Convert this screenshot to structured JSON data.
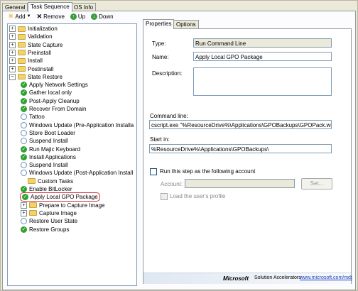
{
  "top_tabs": [
    "General",
    "Task Sequence",
    "OS Info"
  ],
  "toolbar": {
    "add": "Add",
    "remove": "Remove",
    "up": "Up",
    "down": "Down"
  },
  "tree": [
    {
      "label": "Initialization",
      "kind": "group",
      "level": 0
    },
    {
      "label": "Validation",
      "kind": "group",
      "level": 0
    },
    {
      "label": "State Capture",
      "kind": "group",
      "level": 0
    },
    {
      "label": "Preinstall",
      "kind": "group",
      "level": 0
    },
    {
      "label": "Install",
      "kind": "group",
      "level": 0
    },
    {
      "label": "Postinstall",
      "kind": "group",
      "level": 0
    },
    {
      "label": "State Restore",
      "kind": "group-open",
      "level": 0
    },
    {
      "label": "Apply Network Settings",
      "kind": "check",
      "level": 1
    },
    {
      "label": "Gather local only",
      "kind": "check",
      "level": 1
    },
    {
      "label": "Post-Apply Cleanup",
      "kind": "check",
      "level": 1
    },
    {
      "label": "Recover From Domain",
      "kind": "check",
      "level": 1
    },
    {
      "label": "Tattoo",
      "kind": "empty",
      "level": 1
    },
    {
      "label": "Windows Update (Pre-Application Installa",
      "kind": "empty",
      "level": 1
    },
    {
      "label": "Store Boot Loader",
      "kind": "empty",
      "level": 1
    },
    {
      "label": "Suspend Install",
      "kind": "empty",
      "level": 1
    },
    {
      "label": "Run Majic Keyboard",
      "kind": "check",
      "level": 1
    },
    {
      "label": "Install Applications",
      "kind": "check",
      "level": 1
    },
    {
      "label": "Suspend Install",
      "kind": "empty",
      "level": 1
    },
    {
      "label": "Windows Update (Post-Application Install",
      "kind": "empty",
      "level": 1
    },
    {
      "label": "Custom Tasks",
      "kind": "folder",
      "level": 1
    },
    {
      "label": "Enable BitLocker",
      "kind": "check",
      "level": 1
    },
    {
      "label": "Apply Local GPO Package",
      "kind": "check",
      "level": 1,
      "selected": true
    },
    {
      "label": "Prepare to Capture Image",
      "kind": "group",
      "level": 1
    },
    {
      "label": "Capture Image",
      "kind": "group",
      "level": 1
    },
    {
      "label": "Restore User State",
      "kind": "empty",
      "level": 1
    },
    {
      "label": "Restore Groups",
      "kind": "check",
      "level": 1
    }
  ],
  "right_tabs": [
    "Properties",
    "Options"
  ],
  "properties": {
    "type_label": "Type:",
    "type_value": "Run Command Line",
    "name_label": "Name:",
    "name_value": "Apply Local GPO Package",
    "desc_label": "Description:",
    "cmd_label": "Command line:",
    "cmd_value": "cscript.exe \"%ResourceDrive%\\Applications\\GPOBackups\\GPOPack.wsf\"",
    "startin_label": "Start in:",
    "startin_value": "%ResourceDrive%\\Applications\\GPOBackups\\",
    "runas_label": "Run this step as the following account",
    "account_label": "Account:",
    "set_button": "Set...",
    "loadprofile_label": "Load the user's profile"
  },
  "footer": {
    "brand": "Microsoft",
    "product": "Solution Accelerators",
    "link": "www.microsoft.com/mdt"
  },
  "colors": {
    "accent_red": "#d4343e",
    "check_green": "#2fa12f",
    "folder_yellow": "#f2d26c"
  }
}
